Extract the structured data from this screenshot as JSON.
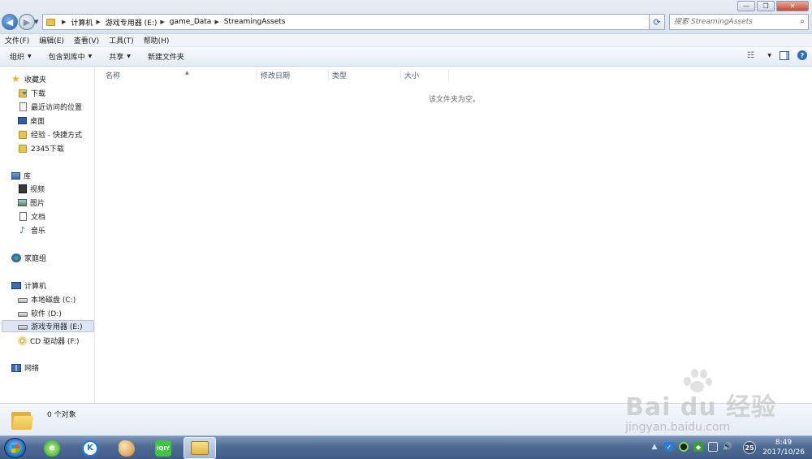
{
  "address_bar": {
    "breadcrumbs": [
      "计算机",
      "游戏专用器 (E:)",
      "game_Data",
      "StreamingAssets"
    ]
  },
  "search": {
    "placeholder": "搜索 StreamingAssets"
  },
  "menu": [
    "文件(F)",
    "编辑(E)",
    "查看(V)",
    "工具(T)",
    "帮助(H)"
  ],
  "commands": {
    "organize": "组织",
    "include_in_library": "包含到库中",
    "share": "共享",
    "new_folder": "新建文件夹"
  },
  "nav": {
    "favorites": "收藏夹",
    "downloads": "下载",
    "recent_places": "最近访问的位置",
    "desktop": "桌面",
    "jingyan_shortcut": "经验 - 快捷方式",
    "downloads_2345": "2345下载",
    "libraries": "库",
    "videos": "视频",
    "pictures": "图片",
    "documents": "文档",
    "music": "音乐",
    "homegroup": "家庭组",
    "computer": "计算机",
    "drive_c": "本地磁盘 (C:)",
    "drive_d": "软件 (D:)",
    "drive_e": "游戏专用器 (E:)",
    "drive_f": "CD 驱动器 (F:)",
    "network": "网络"
  },
  "columns": {
    "name": "名称",
    "modified": "修改日期",
    "type": "类型",
    "size": "大小"
  },
  "empty_message": "该文件夹为空。",
  "details": {
    "count": "0 个对象"
  },
  "taskbar": {
    "iqiyi_label": "iQIY",
    "tray_badge": "25",
    "clock_time": "8:49",
    "clock_date": "2017/10/26"
  },
  "watermark": {
    "brand": "Bai du 经验",
    "url": "jingyan.baidu.com"
  },
  "colors": {
    "accent": "#2f6cc0",
    "selection": "#dce6f3",
    "folder": "#e9c24e"
  }
}
